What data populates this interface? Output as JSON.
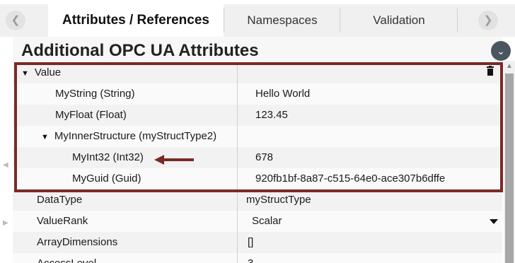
{
  "tabs": {
    "items": [
      {
        "label": "Attributes / References"
      },
      {
        "label": "Namespaces"
      },
      {
        "label": "Validation"
      }
    ],
    "prev_icon": "chevron-left-icon",
    "next_icon": "chevron-right-icon"
  },
  "header": {
    "title": "Additional OPC UA Attributes",
    "collapse_icon": "chevron-down-icon"
  },
  "grid": {
    "rows": [
      {
        "name": "Value",
        "value": "",
        "expanded": true
      },
      {
        "name": "MyString (String)",
        "value": "Hello World"
      },
      {
        "name": "MyFloat (Float)",
        "value": "123.45"
      },
      {
        "name": "MyInnerStructure (myStructType2)",
        "value": "",
        "expanded": true
      },
      {
        "name": "MyInt32 (Int32)",
        "value": "678"
      },
      {
        "name": "MyGuid (Guid)",
        "value": "920fb1bf-8a87-c515-64e0-ace307b6dffe"
      },
      {
        "name": "DataType",
        "value": "myStructType"
      },
      {
        "name": "ValueRank",
        "value": "Scalar"
      },
      {
        "name": "ArrayDimensions",
        "value": "[]"
      },
      {
        "name": "AccessLevel",
        "value": "3"
      }
    ]
  },
  "colors": {
    "highlight": "#7a2a26",
    "accent_button": "#4a5560"
  }
}
